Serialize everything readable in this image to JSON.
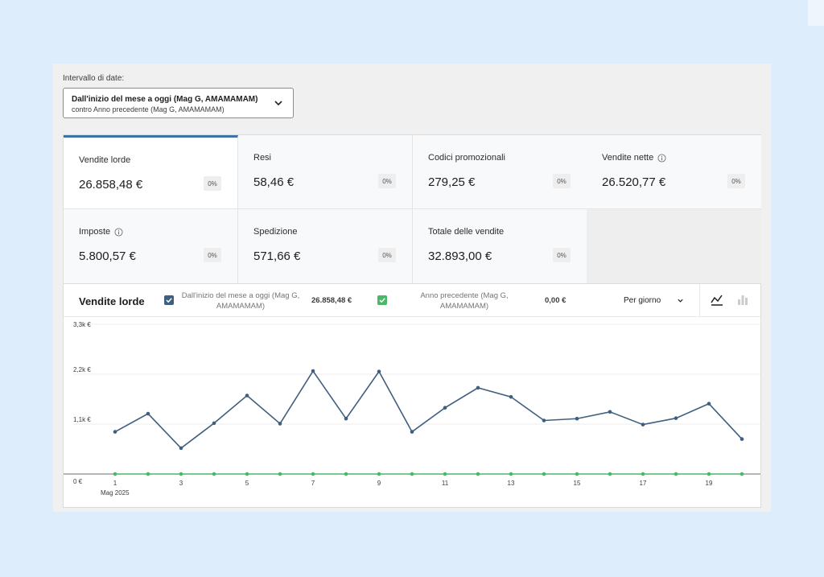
{
  "date_range": {
    "label": "Intervallo di date:",
    "main": "Dall'inizio del mese a oggi (Mag G, AMAMAMAM)",
    "compare": "contro Anno precedente (Mag G, AMAMAMAM)"
  },
  "stats": [
    {
      "label": "Vendite lorde",
      "value": "26.858,48 €",
      "change": "0%",
      "info": false
    },
    {
      "label": "Resi",
      "value": "58,46 €",
      "change": "0%",
      "info": false
    },
    {
      "label": "Codici promozionali",
      "value": "279,25 €",
      "change": "0%",
      "info": false
    },
    {
      "label": "Vendite nette",
      "value": "26.520,77 €",
      "change": "0%",
      "info": true
    },
    {
      "label": "Imposte",
      "value": "5.800,57 €",
      "change": "0%",
      "info": true
    },
    {
      "label": "Spedizione",
      "value": "571,66 €",
      "change": "0%",
      "info": false
    },
    {
      "label": "Totale delle vendite",
      "value": "32.893,00 €",
      "change": "0%",
      "info": false
    }
  ],
  "chart": {
    "title": "Vendite lorde",
    "legend": [
      {
        "label": "Dall'inizio del mese a oggi (Mag G, AMAMAMAM)",
        "value": "26.858,48 €",
        "color": "#3f5f7f"
      },
      {
        "label": "Anno precedente (Mag G, AMAMAMAM)",
        "value": "0,00 €",
        "color": "#4ab866"
      }
    ],
    "interval": "Per giorno"
  },
  "chart_data": {
    "type": "line",
    "x": [
      1,
      2,
      3,
      4,
      5,
      6,
      7,
      8,
      9,
      10,
      11,
      12,
      13,
      14,
      15,
      16,
      17,
      18,
      19,
      20
    ],
    "x_tick_labels": [
      "1",
      "3",
      "5",
      "7",
      "9",
      "11",
      "13",
      "15",
      "17",
      "19"
    ],
    "x_sub_label": "Mag 2025",
    "y_tick_labels": [
      "3,3k €",
      "2,2k €",
      "1,1k €",
      "0 €"
    ],
    "ylim": [
      0,
      3300
    ],
    "series": [
      {
        "name": "Dall'inizio del mese a oggi (Mag G, AMAMAMAM)",
        "color": "#3f5f7f",
        "values": [
          930,
          1330,
          570,
          1120,
          1730,
          1110,
          2270,
          1220,
          2260,
          930,
          1460,
          1900,
          1700,
          1180,
          1220,
          1370,
          1090,
          1230,
          1550,
          770
        ]
      },
      {
        "name": "Anno precedente (Mag G, AMAMAMAM)",
        "color": "#4ab866",
        "values": [
          0,
          0,
          0,
          0,
          0,
          0,
          0,
          0,
          0,
          0,
          0,
          0,
          0,
          0,
          0,
          0,
          0,
          0,
          0,
          0
        ]
      }
    ],
    "grid": true
  }
}
